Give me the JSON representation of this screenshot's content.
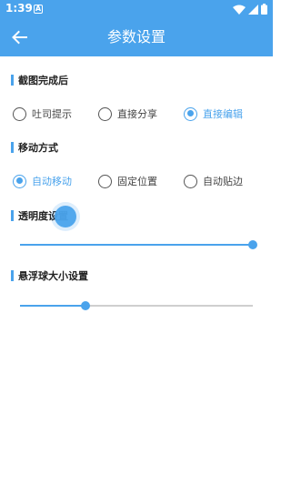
{
  "status_bar": {
    "time": "1:39",
    "notification_letter": "A"
  },
  "app_bar": {
    "title": "参数设置",
    "back_icon": "arrow-left-icon"
  },
  "screenshot_section": {
    "title": "截图完成后",
    "options": [
      {
        "label": "吐司提示",
        "selected": false
      },
      {
        "label": "直接分享",
        "selected": false
      },
      {
        "label": "直接编辑",
        "selected": true
      }
    ]
  },
  "move_section": {
    "title": "移动方式",
    "options": [
      {
        "label": "自动移动",
        "selected": true
      },
      {
        "label": "固定位置",
        "selected": false
      },
      {
        "label": "自动贴边",
        "selected": false
      }
    ]
  },
  "transparency_section": {
    "title": "透明度设置",
    "value_fraction": 1.0
  },
  "size_section": {
    "title": "悬浮球大小设置",
    "value_fraction": 0.28
  },
  "colors": {
    "accent": "#4aa3ec",
    "unselected": "#555555",
    "track": "#cfcfcf"
  }
}
